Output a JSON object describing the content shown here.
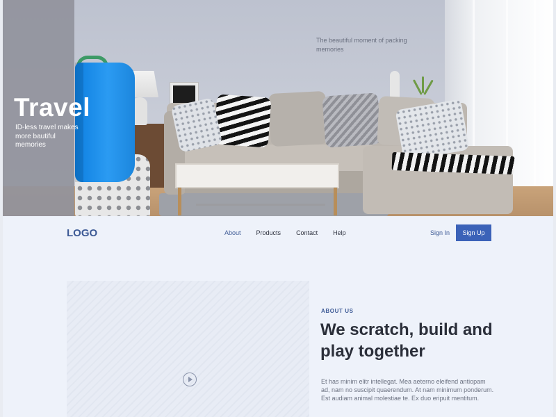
{
  "hero": {
    "title": "Travel",
    "subtitle": "ID-less travel makes more bautiful memories",
    "caption": "The beautiful moment of packing memories"
  },
  "header": {
    "logo": "LOGO",
    "nav": [
      "About",
      "Products",
      "Contact",
      "Help"
    ],
    "active_nav": "About",
    "sign_in": "Sign In",
    "sign_up": "Sign Up"
  },
  "about": {
    "eyebrow": "ABOUT US",
    "headline": "We scratch, build and play together",
    "paragraph": "Et has minim elitr intellegat. Mea aeterno eleifend antiopam ad, nam no suscipit quaerendum. At nam minimum ponderum. Est audiam animal molestiae te. Ex duo eripuit mentitum."
  },
  "media": {
    "play_icon": "play-circle-icon"
  },
  "colors": {
    "accent": "#3b62b8",
    "brand_text": "#3d5a95",
    "heading": "#2b2f3a",
    "body_text": "#6b7180",
    "page_bg": "#eef2fa"
  }
}
